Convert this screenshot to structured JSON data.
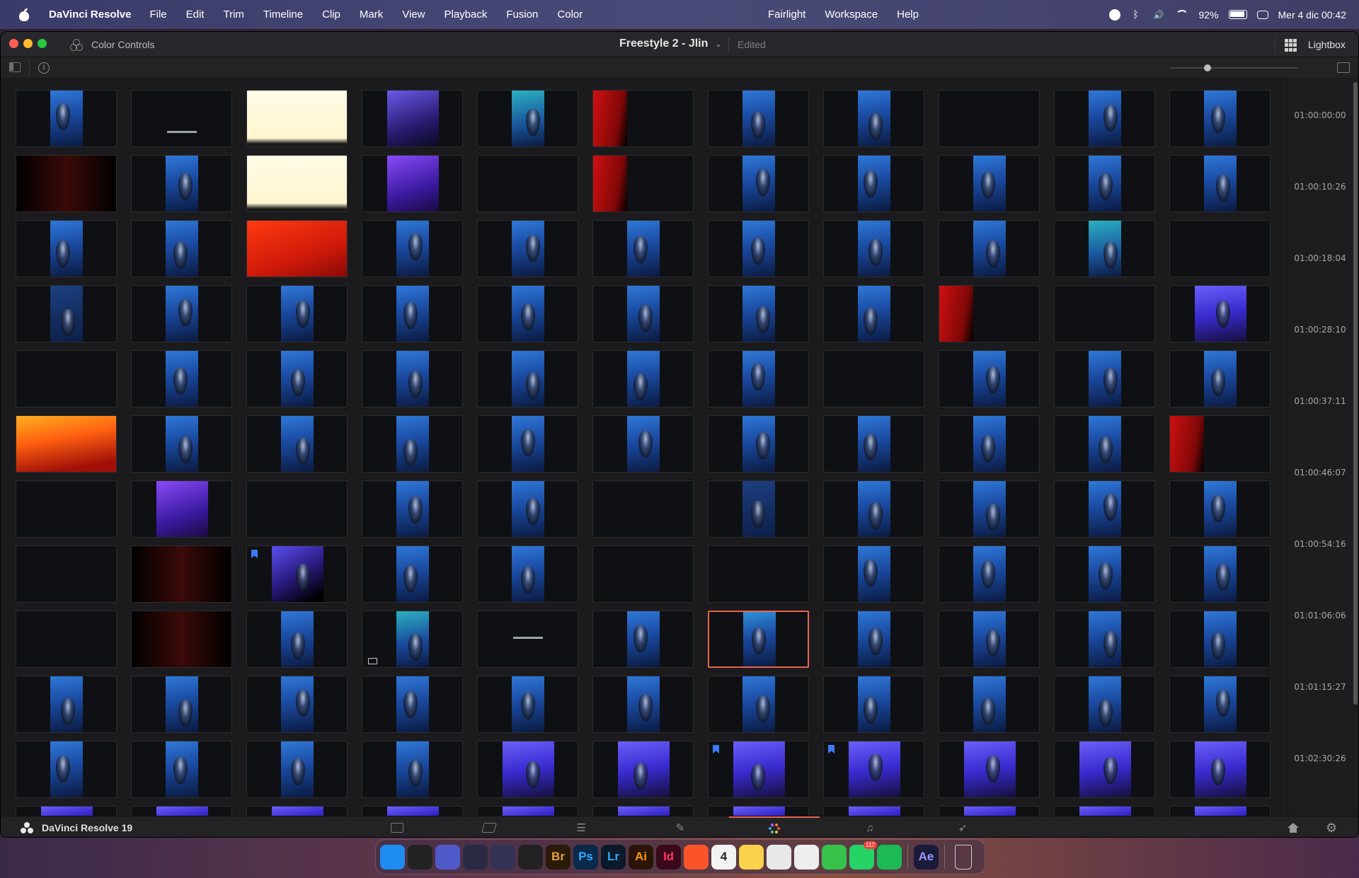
{
  "menubar": {
    "app_name": "DaVinci Resolve",
    "menus": [
      "File",
      "Edit",
      "Trim",
      "Timeline",
      "Clip",
      "Mark",
      "View",
      "Playback",
      "Fusion",
      "Color"
    ],
    "menus_right": [
      "Fairlight",
      "Workspace",
      "Help"
    ],
    "battery": "92%",
    "datetime": "Mer 4 dic  00:42"
  },
  "window": {
    "panel_label": "Color Controls",
    "project_title": "Freestyle 2 - Jlin",
    "project_status": "Edited",
    "lightbox_label": "Lightbox",
    "zoom_level": 0.28
  },
  "timecodes": [
    "01:00:00:00",
    "01:00:10:26",
    "01:00:18:04",
    "01:00:28:10",
    "01:00:37:11",
    "01:00:46:07",
    "01:00:54:16",
    "01:01:06:06",
    "01:01:15:27",
    "01:02:30:26"
  ],
  "thumbnails": [
    [
      "blue",
      "title",
      "cream",
      "purple-room",
      "teal",
      "red",
      "blue",
      "blue",
      "black",
      "blue",
      "blue"
    ],
    [
      "darkred",
      "blue",
      "cream",
      "purple",
      "black",
      "red",
      "blue",
      "blue",
      "blue",
      "blue",
      "blue"
    ],
    [
      "blue",
      "blue",
      "orange-red",
      "blue",
      "blue",
      "blue",
      "blue",
      "blue",
      "blue",
      "teal",
      "black"
    ],
    [
      "darkblue",
      "blue",
      "blue",
      "blue",
      "blue",
      "blue",
      "blue",
      "blue",
      "red",
      "black",
      "violet"
    ],
    [
      "black",
      "blue",
      "blue",
      "blue",
      "blue",
      "blue",
      "blue",
      "black",
      "blue",
      "blue",
      "blue"
    ],
    [
      "orange",
      "blue",
      "blue",
      "blue",
      "blue",
      "blue",
      "blue",
      "blue",
      "blue",
      "blue",
      "red"
    ],
    [
      "black",
      "purple",
      "black",
      "blue",
      "blue",
      "black",
      "darkblue",
      "blue",
      "blue",
      "blue",
      "blue"
    ],
    [
      "black",
      "darkred",
      "purple-flag",
      "blue",
      "blue",
      "black",
      "black",
      "blue",
      "blue",
      "blue",
      "blue"
    ],
    [
      "black",
      "darkred",
      "blue",
      "blue-icon",
      "credits",
      "blue",
      "blue-selected",
      "blue",
      "blue",
      "blue",
      "blue"
    ],
    [
      "blue",
      "blue",
      "blue",
      "blue",
      "blue",
      "blue",
      "blue",
      "blue",
      "blue",
      "blue",
      "blue"
    ],
    [
      "blue",
      "blue",
      "blue",
      "blue",
      "violet",
      "violet",
      "violet-flag",
      "violet-flag",
      "violet",
      "violet",
      "violet"
    ],
    [
      "violet",
      "violet",
      "violet",
      "violet",
      "violet",
      "violet",
      "violet",
      "violet",
      "violet",
      "violet",
      "violet"
    ]
  ],
  "bottombar": {
    "app_version": "DaVinci Resolve 19",
    "pages": [
      "media-icon",
      "cut-icon",
      "edit-icon",
      "fusion-icon",
      "color-icon",
      "fairlight-icon",
      "deliver-icon"
    ],
    "active_page": "color-icon"
  },
  "dock": {
    "items": [
      {
        "name": "finder",
        "label": "",
        "color": "#1e8cf0"
      },
      {
        "name": "capcut",
        "label": "",
        "color": "#222"
      },
      {
        "name": "teams",
        "label": "",
        "color": "#5059c9"
      },
      {
        "name": "davinci-resolve",
        "label": "",
        "color": "#2a2a44"
      },
      {
        "name": "davinci-resolve-2",
        "label": "",
        "color": "#335"
      },
      {
        "name": "figma",
        "label": "",
        "color": "#222"
      },
      {
        "name": "bridge",
        "label": "Br",
        "color": "#2a1a08"
      },
      {
        "name": "photoshop",
        "label": "Ps",
        "color": "#0a2a4a"
      },
      {
        "name": "lightroom",
        "label": "Lr",
        "color": "#0a1a2a"
      },
      {
        "name": "illustrator",
        "label": "Ai",
        "color": "#2a1508"
      },
      {
        "name": "indesign",
        "label": "Id",
        "color": "#3a0a1a"
      },
      {
        "name": "brave",
        "label": "",
        "color": "#fb542b"
      },
      {
        "name": "calendar",
        "label": "4",
        "color": "#f3f3f3"
      },
      {
        "name": "notes",
        "label": "",
        "color": "#f7d24a"
      },
      {
        "name": "photos",
        "label": "",
        "color": "#e8e8e8"
      },
      {
        "name": "remote",
        "label": "",
        "color": "#eee"
      },
      {
        "name": "messages",
        "label": "",
        "color": "#36c24b"
      },
      {
        "name": "whatsapp",
        "label": "",
        "color": "#25d366",
        "badge": "117"
      },
      {
        "name": "spotify",
        "label": "",
        "color": "#1db954"
      },
      {
        "name": "after-effects",
        "label": "Ae",
        "color": "#1a1a3a"
      },
      {
        "name": "trash",
        "label": "",
        "color": "transparent"
      }
    ]
  }
}
